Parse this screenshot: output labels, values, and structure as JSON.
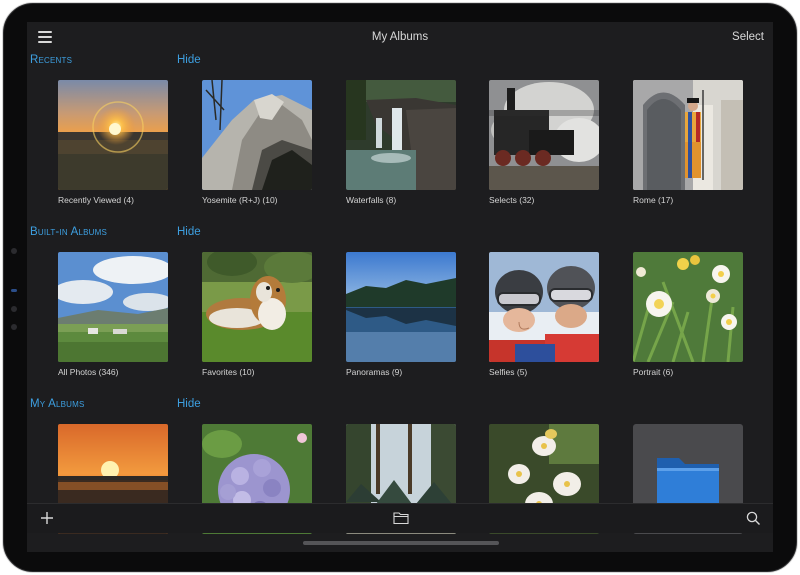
{
  "navbar": {
    "title": "My Albums",
    "select_label": "Select"
  },
  "sections": {
    "recents": {
      "title": "Recents",
      "hide_label": "Hide",
      "albums": [
        {
          "label": "Recently Viewed (4)"
        },
        {
          "label": "Yosemite (R+J) (10)"
        },
        {
          "label": "Waterfalls (8)"
        },
        {
          "label": "Selects (32)"
        },
        {
          "label": "Rome (17)"
        }
      ]
    },
    "builtin": {
      "title": "Built-in Albums",
      "hide_label": "Hide",
      "albums": [
        {
          "label": "All Photos (346)"
        },
        {
          "label": "Favorites (10)"
        },
        {
          "label": "Panoramas (9)"
        },
        {
          "label": "Selfies (5)"
        },
        {
          "label": "Portrait (6)"
        }
      ]
    },
    "my_albums": {
      "title": "My Albums",
      "hide_label": "Hide"
    }
  },
  "toolbar": {
    "add_icon": "plus-icon",
    "folder_icon": "folder-icon",
    "search_icon": "search-icon"
  },
  "colors": {
    "accent": "#3d9fe0",
    "background": "#1d1d1f",
    "folder": "#2f7ed8"
  }
}
